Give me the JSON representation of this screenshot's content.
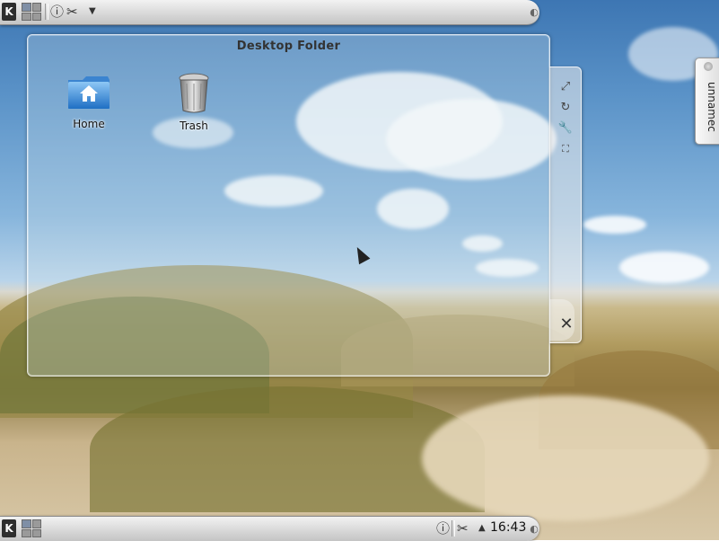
{
  "desktop": {
    "folder_title": "Desktop Folder",
    "icons": [
      {
        "label": "Home",
        "icon": "home-folder-icon"
      },
      {
        "label": "Trash",
        "icon": "trash-icon"
      }
    ]
  },
  "top_panel": {
    "launcher_icon": "kde-menu-icon",
    "pager_icon": "pager-icon",
    "tray_icons": [
      "info-icon",
      "scissors-icon",
      "dropdown-arrow-icon"
    ]
  },
  "bottom_panel": {
    "launcher_icon": "kde-menu-icon",
    "pager_icon": "pager-icon",
    "tray_icons": [
      "info-icon",
      "scissors-icon",
      "tray-expand-icon"
    ],
    "clock": "16:43"
  },
  "handle": {
    "buttons": [
      "resize-icon",
      "rotate-icon",
      "configure-icon",
      "maximize-icon"
    ],
    "close_icon": "close-icon"
  },
  "side_tab": {
    "label": "unnamec"
  },
  "colors": {
    "panel": "#d9d9d9",
    "sky": "#5b93c8",
    "folder_bg": "rgba(210,225,235,0.28)"
  }
}
